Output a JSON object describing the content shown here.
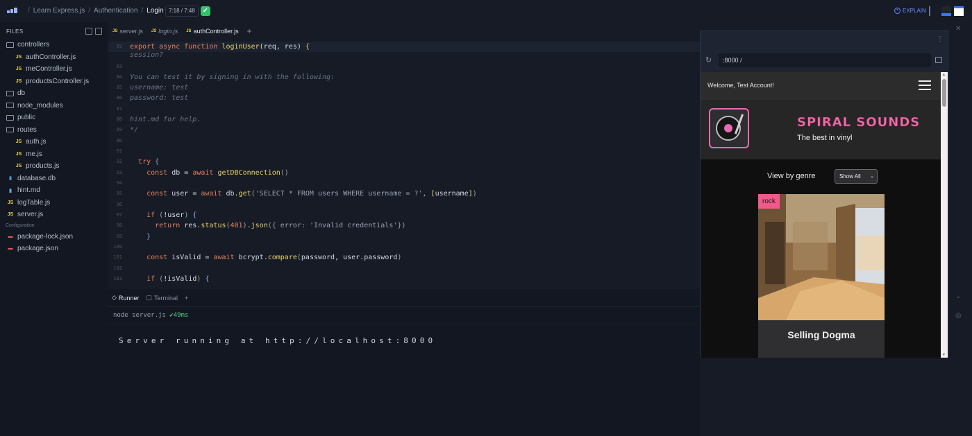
{
  "topbar": {
    "crumbs": [
      "Learn Express.js",
      "Authentication",
      "Login"
    ],
    "timer": "7:18 / 7:48",
    "explain": "EXPLAIN"
  },
  "sidebar": {
    "header": "FILES",
    "section_label": "Configuration",
    "items": [
      {
        "label": "controllers",
        "type": "folder-open",
        "indent": 0
      },
      {
        "label": "authController.js",
        "type": "js",
        "indent": 1
      },
      {
        "label": "meController.js",
        "type": "js",
        "indent": 1
      },
      {
        "label": "productsController.js",
        "type": "js",
        "indent": 1
      },
      {
        "label": "db",
        "type": "folder",
        "indent": 0
      },
      {
        "label": "node_modules",
        "type": "folder",
        "indent": 0
      },
      {
        "label": "public",
        "type": "folder",
        "indent": 0
      },
      {
        "label": "routes",
        "type": "folder-open",
        "indent": 0
      },
      {
        "label": "auth.js",
        "type": "js",
        "indent": 1
      },
      {
        "label": "me.js",
        "type": "js",
        "indent": 1
      },
      {
        "label": "products.js",
        "type": "js",
        "indent": 1
      },
      {
        "label": "database.db",
        "type": "db",
        "indent": 0
      },
      {
        "label": "hint.md",
        "type": "md",
        "indent": 0
      },
      {
        "label": "logTable.js",
        "type": "js",
        "indent": 0
      },
      {
        "label": "server.js",
        "type": "js",
        "indent": 0
      }
    ],
    "config_items": [
      {
        "label": "package-lock.json",
        "type": "json"
      },
      {
        "label": "package.json",
        "type": "json"
      }
    ]
  },
  "editor": {
    "tabs": [
      {
        "label": "server.js",
        "active": false,
        "italic": false
      },
      {
        "label": "login.js",
        "active": false,
        "italic": true
      },
      {
        "label": "authController.js",
        "active": true,
        "italic": false
      }
    ],
    "lines": [
      {
        "n": "59",
        "html": "<span class='k'>export async function</span> <span class='f'>loginUser</span><span class='v'>(req, res) </span><span class='f'>{</span>",
        "hl": true
      },
      {
        "n": "",
        "html": "<span class='c'>session?</span>"
      },
      {
        "n": "83",
        "html": ""
      },
      {
        "n": "84",
        "html": "<span class='c'>You can test it by signing in with the following:</span>"
      },
      {
        "n": "85",
        "html": "<span class='c'>username: test</span>"
      },
      {
        "n": "86",
        "html": "<span class='c'>password: test</span>"
      },
      {
        "n": "87",
        "html": ""
      },
      {
        "n": "88",
        "html": "<span class='c'>hint.md for help.</span>"
      },
      {
        "n": "89",
        "html": "<span class='c'>*/</span>"
      },
      {
        "n": "90",
        "html": ""
      },
      {
        "n": "91",
        "html": ""
      },
      {
        "n": "92",
        "html": "  <span class='k'>try</span> <span class='s'>{</span>"
      },
      {
        "n": "93",
        "html": "    <span class='k'>const</span> db = <span class='k'>await</span> <span class='f'>getDBConnection</span><span class='s'>()</span>"
      },
      {
        "n": "94",
        "html": ""
      },
      {
        "n": "95",
        "html": "    <span class='k'>const</span> user = <span class='k'>await</span> db.<span class='f'>get</span><span class='s'>('SELECT * FROM users WHERE username = ?', </span><span class='f'>[</span>username<span class='f'>]</span><span class='s'>)</span>"
      },
      {
        "n": "96",
        "html": ""
      },
      {
        "n": "97",
        "html": "    <span class='k'>if</span> <span class='s'>(</span>!user<span class='s'>)</span> <span class='b'>{</span>"
      },
      {
        "n": "98",
        "html": "      <span class='k'>return</span> res.<span class='f'>status</span><span class='s'>(</span><span class='n'>401</span><span class='s'>)</span>.<span class='f'>json</span><span class='s'>({ error: 'Invalid credentials'})</span>"
      },
      {
        "n": "99",
        "html": "    <span class='b'>}</span>"
      },
      {
        "n": "100",
        "html": ""
      },
      {
        "n": "101",
        "html": "    <span class='k'>const</span> isValid = <span class='k'>await</span> bcrypt.<span class='f'>compare</span><span class='s'>(</span>password, user.password<span class='s'>)</span>"
      },
      {
        "n": "102",
        "html": ""
      },
      {
        "n": "103",
        "html": "    <span class='k'>if</span> <span class='s'>(</span>!isValid<span class='s'>)</span> <span class='b'>{</span>"
      }
    ]
  },
  "runner": {
    "tabs": [
      {
        "label": "Runner",
        "active": true
      },
      {
        "label": "Terminal",
        "active": false
      }
    ],
    "command": "node server.js",
    "command_status": "✔49ms",
    "output": "Server running at http://localhost:8000"
  },
  "preview": {
    "url": ":8000 /",
    "site": {
      "welcome": "Welcome, Test Account!",
      "brand": "SPIRAL SOUNDS",
      "tagline": "The best in vinyl",
      "genre_label": "View by genre",
      "genre_selected": "Show All",
      "card": {
        "tag": "rock",
        "title": "Selling Dogma"
      }
    }
  }
}
